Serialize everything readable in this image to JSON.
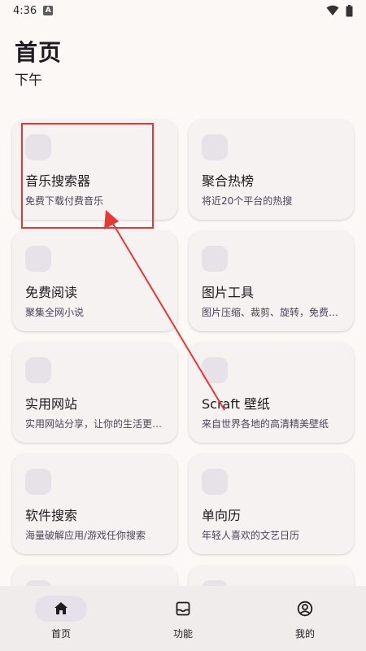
{
  "status_bar": {
    "time": "4:36",
    "indicator": "A"
  },
  "header": {
    "title": "首页",
    "subtitle": "下午"
  },
  "cards": [
    {
      "title": "音乐搜索器",
      "subtitle": "免费下载付费音乐"
    },
    {
      "title": "聚合热榜",
      "subtitle": "将近20个平台的热搜"
    },
    {
      "title": "免费阅读",
      "subtitle": "聚集全网小说"
    },
    {
      "title": "图片工具",
      "subtitle": "图片压缩、裁剪、旋转，免费…"
    },
    {
      "title": "实用网站",
      "subtitle": "实用网站分享，让你的生活更…"
    },
    {
      "title": "Scraft 壁纸",
      "subtitle": "来自世界各地的高清精美壁纸"
    },
    {
      "title": "软件搜索",
      "subtitle": "海量破解应用/游戏任你搜索"
    },
    {
      "title": "单向历",
      "subtitle": "年轻人喜欢的文艺日历"
    }
  ],
  "bottom_nav": [
    {
      "label": "首页",
      "icon": "home-icon",
      "active": true
    },
    {
      "label": "功能",
      "icon": "inbox-icon",
      "active": false
    },
    {
      "label": "我的",
      "icon": "account-circle-icon",
      "active": false
    }
  ],
  "colors": {
    "annotation": "#e53935",
    "background": "#fbf8f6",
    "card": "#f6f2f1",
    "nav": "#f1ecec"
  }
}
